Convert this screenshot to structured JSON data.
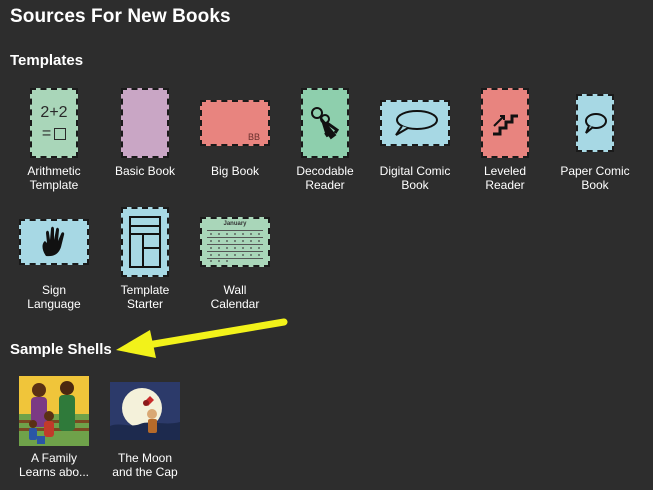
{
  "page": {
    "title": "Sources For New Books"
  },
  "sections": {
    "templates": "Templates",
    "shells": "Sample Shells"
  },
  "templates": [
    {
      "label1": "Arithmetic",
      "label2": "Template",
      "icon": "arithmetic-icon",
      "color": "#a9d6b9"
    },
    {
      "label1": "Basic Book",
      "label2": "",
      "icon": "blank-page",
      "color": "#c9a6c5"
    },
    {
      "label1": "Big Book",
      "label2": "",
      "icon": "big-book-page",
      "color": "#e8847f"
    },
    {
      "label1": "Decodable",
      "label2": "Reader",
      "icon": "keys-icon",
      "color": "#8ecfad"
    },
    {
      "label1": "Digital Comic",
      "label2": "Book",
      "icon": "speech-bubble-icon",
      "color": "#a7d8e4"
    },
    {
      "label1": "Leveled",
      "label2": "Reader",
      "icon": "stairs-icon",
      "color": "#e8847f"
    },
    {
      "label1": "Paper Comic",
      "label2": "Book",
      "icon": "speech-bubble-icon",
      "color": "#a7d8e4"
    },
    {
      "label1": "Sign",
      "label2": "Language",
      "icon": "hand-icon",
      "color": "#a7d8e4"
    },
    {
      "label1": "Template",
      "label2": "Starter",
      "icon": "layout-icon",
      "color": "#a7d8e4"
    },
    {
      "label1": "Wall",
      "label2": "Calendar",
      "icon": "calendar-icon",
      "color": "#a9d6b9"
    }
  ],
  "thumb_text": {
    "arithmetic_top": "2+2",
    "arithmetic_bottom": "=",
    "big_book_mark": "BB",
    "calendar_month": "January"
  },
  "shells": [
    {
      "label1": "A Family",
      "label2": "Learns abo...",
      "icon": "family-illustration"
    },
    {
      "label1": "The Moon",
      "label2": "and the Cap",
      "icon": "moon-illustration"
    }
  ],
  "colors": {
    "background": "#2d2d2d",
    "text": "#ffffff",
    "arrow": "#f2f21a"
  }
}
